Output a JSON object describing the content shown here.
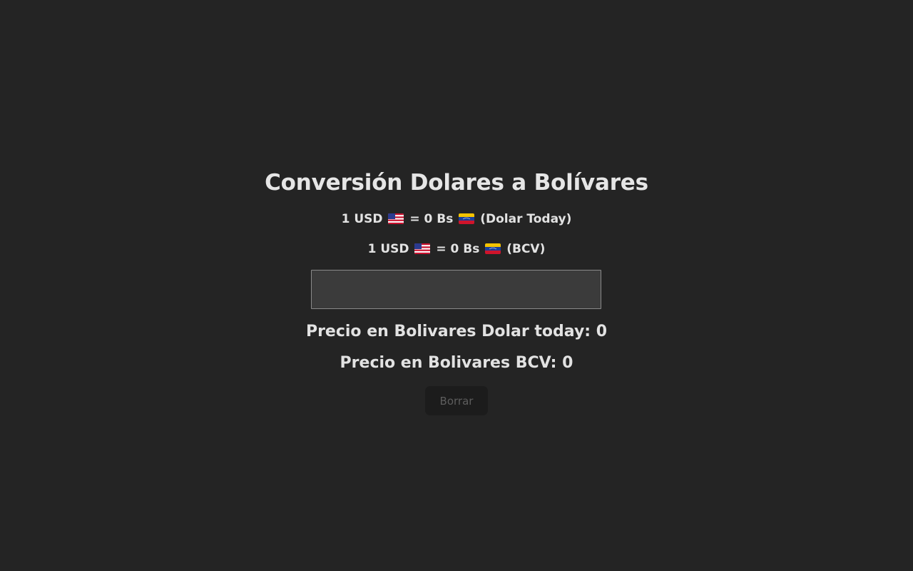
{
  "header": {
    "title": "Conversión Dolares a Bolívares"
  },
  "rates": [
    {
      "prefix": "1 USD",
      "from_flag": "us-flag-icon",
      "middle": "= 0 Bs",
      "to_flag": "venezuela-flag-icon",
      "suffix": "(Dolar Today)"
    },
    {
      "prefix": "1 USD",
      "from_flag": "us-flag-icon",
      "middle": "= 0 Bs",
      "to_flag": "venezuela-flag-icon",
      "suffix": "(BCV)"
    }
  ],
  "input": {
    "value": "",
    "placeholder": ""
  },
  "results": {
    "dolar_today": "Precio en Bolivares Dolar today: 0",
    "bcv": "Precio en Bolivares BCV: 0"
  },
  "actions": {
    "clear_label": "Borrar"
  },
  "colors": {
    "background": "#242424",
    "text": "#e2e2e2",
    "input_bg": "#3b3b3b",
    "button_bg": "#1c1c1c",
    "button_text": "#5d5d5d"
  }
}
